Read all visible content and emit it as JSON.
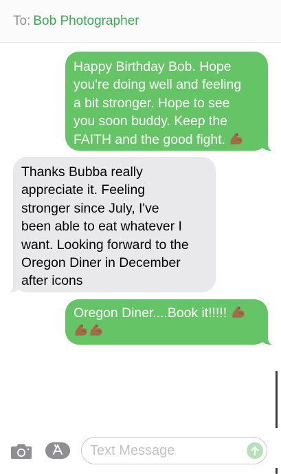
{
  "header": {
    "to_label": "To:",
    "recipient": "Bob Photographer"
  },
  "messages": [
    {
      "direction": "outgoing",
      "lines": [
        "Happy Birthday Bob.  Hope",
        "you're doing well and feeling",
        "a bit stronger.  Hope to see",
        "you soon buddy.  Keep the",
        "FAITH and the good fight."
      ],
      "trailing_emoji": [
        "flexed-biceps-icon"
      ]
    },
    {
      "direction": "incoming",
      "lines": [
        "Thanks Bubba really",
        "appreciate it. Feeling",
        "stronger since July,  I've",
        "been able to eat whatever I",
        "want. Looking forward to the",
        "Oregon Diner in December",
        "after icons"
      ]
    },
    {
      "direction": "outgoing",
      "lines": [
        "Oregon Diner....Book it!!!!!"
      ],
      "trailing_emoji": [
        "flexed-biceps-icon",
        "flexed-biceps-icon",
        "flexed-biceps-icon"
      ]
    }
  ],
  "input_bar": {
    "placeholder": "Text Message",
    "value": ""
  },
  "colors": {
    "outgoing_bubble": "#65c466",
    "incoming_bubble": "#e9e9eb",
    "accent": "#3aaa4d"
  }
}
